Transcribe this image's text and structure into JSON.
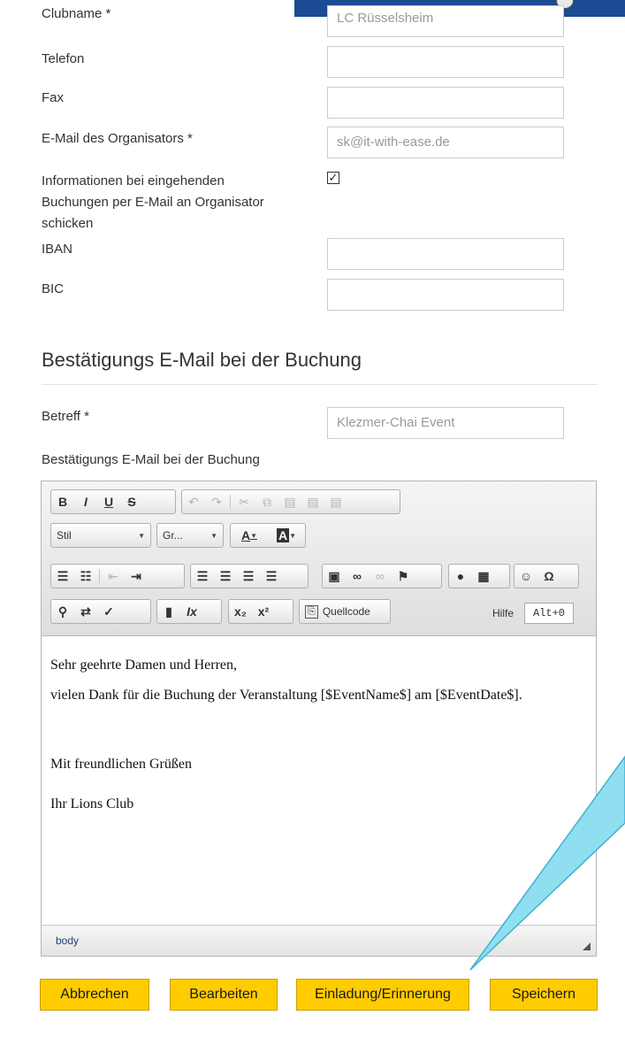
{
  "form": {
    "clubname_label": "Clubname *",
    "clubname_value": "LC Rüsselsheim",
    "telefon_label": "Telefon",
    "telefon_value": "",
    "fax_label": "Fax",
    "fax_value": "",
    "email_label": "E-Mail des Organisators *",
    "email_value": "sk@it-with-ease.de",
    "notify_label_1": "Informationen bei eingehenden",
    "notify_label_2": "Buchungen per E-Mail an Organisator",
    "notify_label_3": "schicken",
    "notify_checked": true,
    "checkmark": "✓",
    "iban_label": "IBAN",
    "iban_value": "",
    "bic_label": "BIC",
    "bic_value": ""
  },
  "confirmation": {
    "section_title": "Bestätigungs E-Mail bei der Buchung",
    "subject_label": "Betreff *",
    "subject_value": "Klezmer-Chai Event",
    "editor_label": "Bestätigungs E-Mail bei der Buchung"
  },
  "toolbar": {
    "bold": "B",
    "italic": "I",
    "underline": "U",
    "strike": "S",
    "style_combo": "Stil",
    "size_combo": "Gr...",
    "text_color": "A",
    "bg_color": "A",
    "source_label": "Quellcode",
    "help_label": "Hilfe",
    "help_shortcut": "Alt+0",
    "subscript": "x₂",
    "superscript": "x²",
    "omega": "Ω"
  },
  "editor": {
    "line1": "Sehr geehrte Damen und Herren,",
    "line2": "vielen Dank für die Buchung der Veranstaltung [$EventName$] am [$EventDate$].",
    "line3": "Mit freundlichen Grüßen",
    "line4": "Ihr Lions Club",
    "status_path": "body"
  },
  "buttons": {
    "cancel": "Abbrechen",
    "edit": "Bearbeiten",
    "invite": "Einladung/Erinnerung",
    "save": "Speichern"
  },
  "colors": {
    "header_blue": "#1b4b92",
    "button_yellow": "#ffcc00",
    "callout_cyan": "#8fdff0"
  }
}
